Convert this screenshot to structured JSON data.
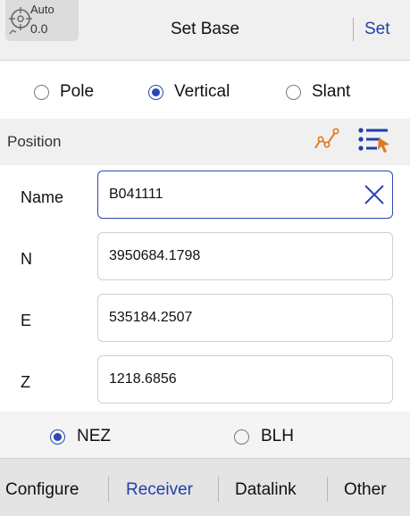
{
  "header": {
    "status_mode": "Auto",
    "status_value": "0.0",
    "title": "Set Base",
    "set_label": "Set"
  },
  "antenna": {
    "options": [
      "Pole",
      "Vertical",
      "Slant"
    ],
    "selected": "Vertical"
  },
  "section": {
    "title": "Position"
  },
  "fields": {
    "name": {
      "label": "Name",
      "value": "B041111"
    },
    "n": {
      "label": "N",
      "value": "3950684.1798"
    },
    "e": {
      "label": "E",
      "value": "535184.2507"
    },
    "z": {
      "label": "Z",
      "value": "1218.6856"
    }
  },
  "coord_type": {
    "options": [
      "NEZ",
      "BLH"
    ],
    "selected": "NEZ"
  },
  "tabs": {
    "items": [
      "Configure",
      "Receiver",
      "Datalink",
      "Other"
    ],
    "active": "Receiver"
  },
  "colors": {
    "accent": "#1f3fa8",
    "icon_orange": "#e07a1f",
    "icon_blue": "#1f3fa8"
  }
}
